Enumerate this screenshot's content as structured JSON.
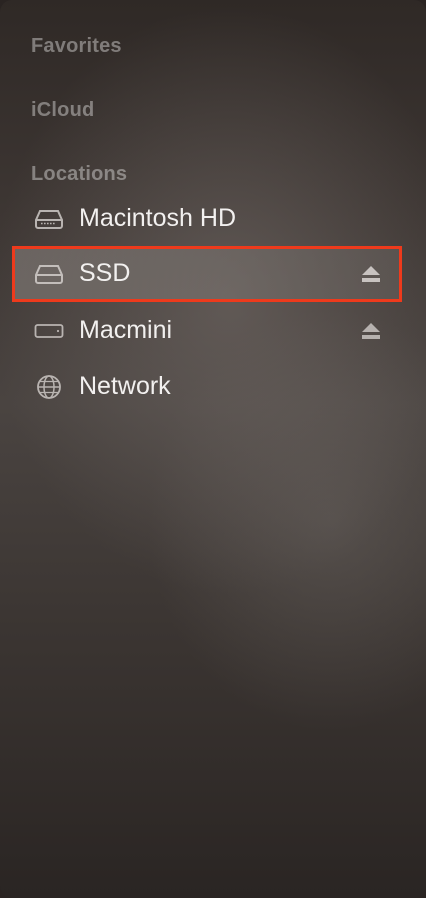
{
  "sidebar": {
    "sections": {
      "favorites": "Favorites",
      "icloud": "iCloud",
      "locations": "Locations"
    },
    "locations": [
      {
        "label": "Macintosh HD",
        "icon": "internal-drive-icon",
        "ejectable": false,
        "selected": false
      },
      {
        "label": "SSD",
        "icon": "external-drive-icon",
        "ejectable": true,
        "selected": true
      },
      {
        "label": "Macmini",
        "icon": "network-computer-icon",
        "ejectable": true,
        "selected": false
      },
      {
        "label": "Network",
        "icon": "globe-icon",
        "ejectable": false,
        "selected": false
      }
    ]
  },
  "colors": {
    "highlight_border": "#ee3a1c",
    "text": "#f2f0ef",
    "section_title": "rgba(255,255,255,0.38)"
  }
}
